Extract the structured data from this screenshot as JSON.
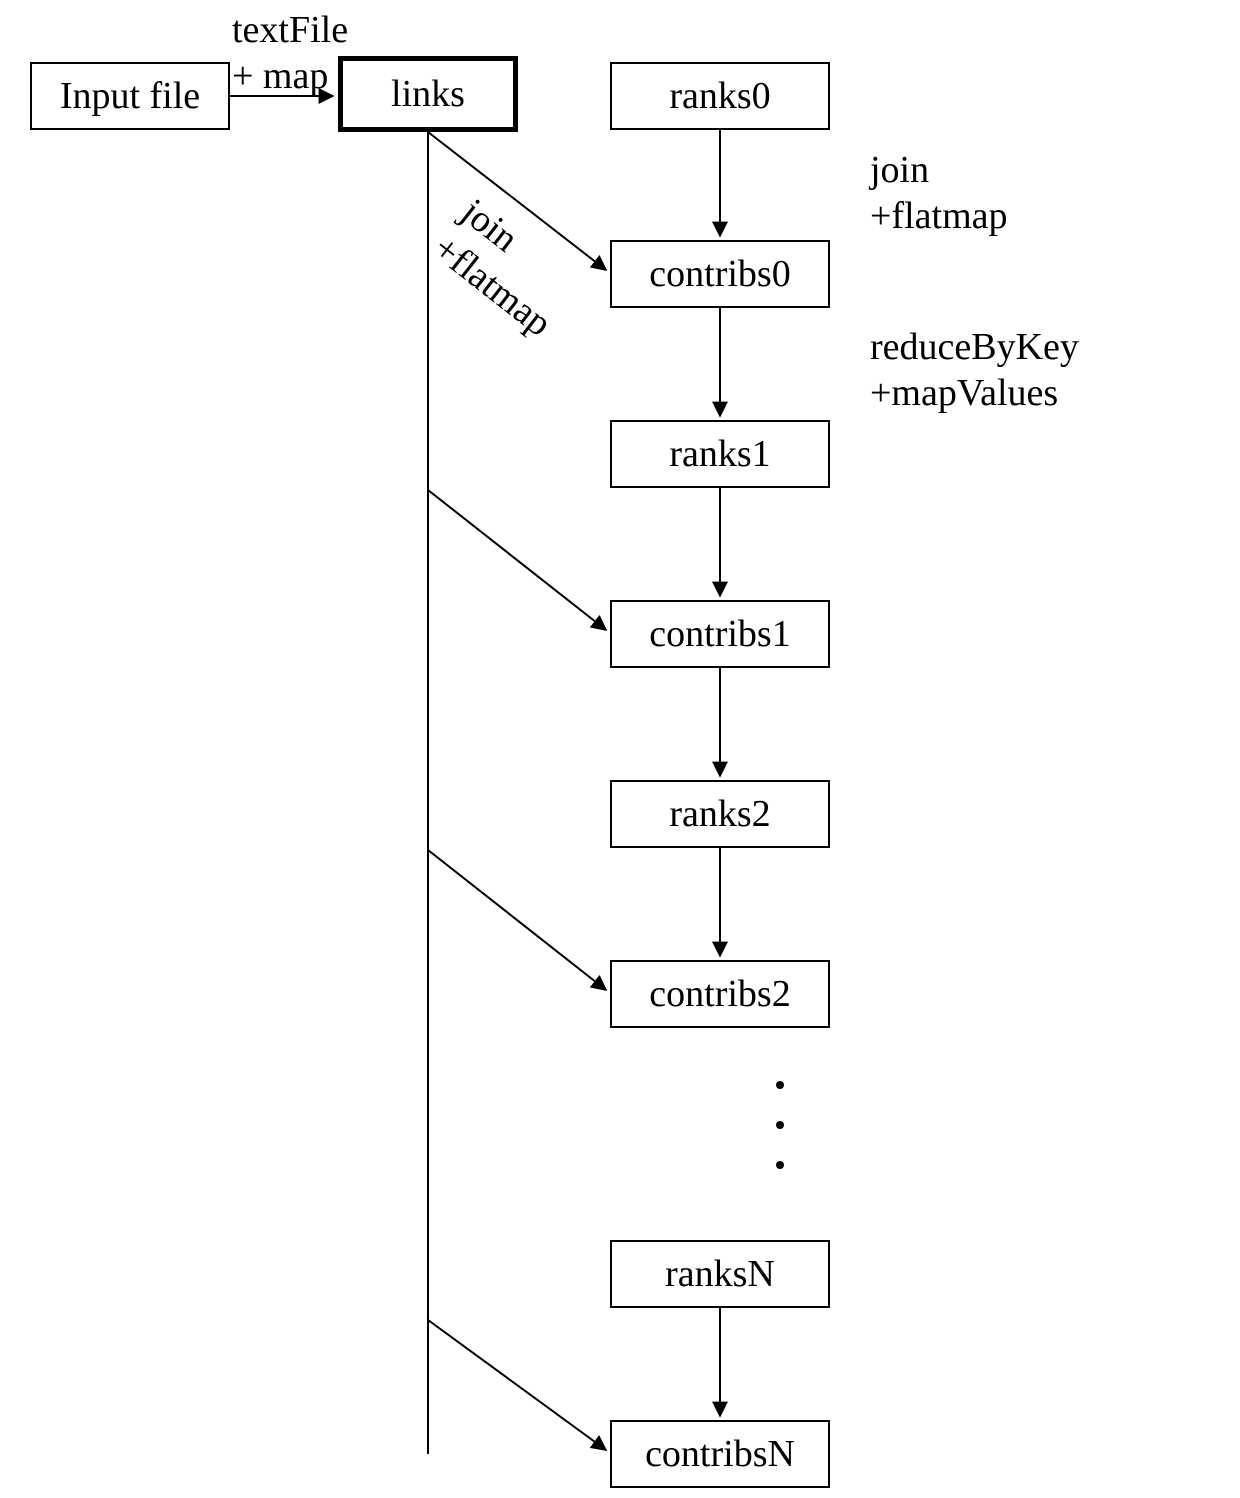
{
  "nodes": {
    "input_file": "Input file",
    "links": "links",
    "ranks0": "ranks0",
    "contribs0": "contribs0",
    "ranks1": "ranks1",
    "contribs1": "contribs1",
    "ranks2": "ranks2",
    "contribs2": "contribs2",
    "ranksN": "ranksN",
    "contribsN": "contribsN"
  },
  "edge_labels": {
    "textfile_map_l1": "textFile",
    "textfile_map_l2": "+ map",
    "join_flatmap_right_l1": "join",
    "join_flatmap_right_l2": "+flatmap",
    "join_flatmap_diag_l1": "join",
    "join_flatmap_diag_l2": "+flatmap",
    "reduce_mapvalues_l1": "reduceByKey",
    "reduce_mapvalues_l2": "+mapValues"
  }
}
